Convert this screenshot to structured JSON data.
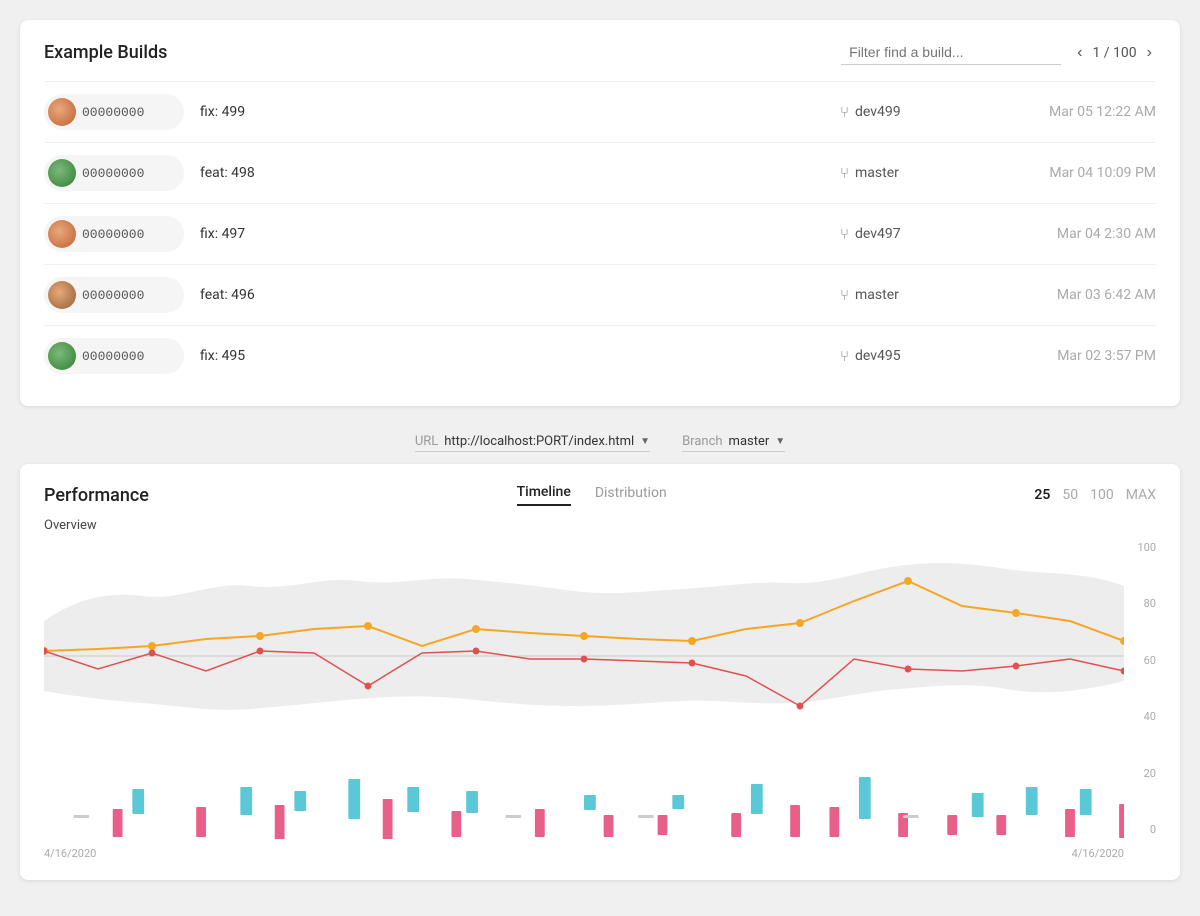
{
  "builds": {
    "title": "Example Builds",
    "filter_placeholder": "Filter find a build...",
    "pagination": {
      "current": 1,
      "total": 100,
      "label": "1 / 100"
    },
    "rows": [
      {
        "id": "00000000",
        "message": "fix: 499",
        "branch": "dev499",
        "date": "Mar 05 12:22 AM",
        "avatar_class": "avatar-1"
      },
      {
        "id": "00000000",
        "message": "feat: 498",
        "branch": "master",
        "date": "Mar 04 10:09 PM",
        "avatar_class": "avatar-2"
      },
      {
        "id": "00000000",
        "message": "fix: 497",
        "branch": "dev497",
        "date": "Mar 04 2:30 AM",
        "avatar_class": "avatar-3"
      },
      {
        "id": "00000000",
        "message": "feat: 496",
        "branch": "master",
        "date": "Mar 03 6:42 AM",
        "avatar_class": "avatar-4"
      },
      {
        "id": "00000000",
        "message": "fix: 495",
        "branch": "dev495",
        "date": "Mar 02 3:57 PM",
        "avatar_class": "avatar-5"
      }
    ]
  },
  "url_branch": {
    "url_label": "URL",
    "url_value": "http://localhost:PORT/index.html",
    "branch_label": "Branch",
    "branch_value": "master"
  },
  "performance": {
    "title": "Performance",
    "tabs": [
      "Timeline",
      "Distribution"
    ],
    "active_tab": "Timeline",
    "counts": [
      "25",
      "50",
      "100",
      "MAX"
    ],
    "active_count": "25",
    "chart_label": "Overview",
    "y_labels": [
      "100",
      "80",
      "60",
      "40",
      "20",
      "0"
    ],
    "date_start": "4/16/2020",
    "date_end": "4/16/2020"
  }
}
